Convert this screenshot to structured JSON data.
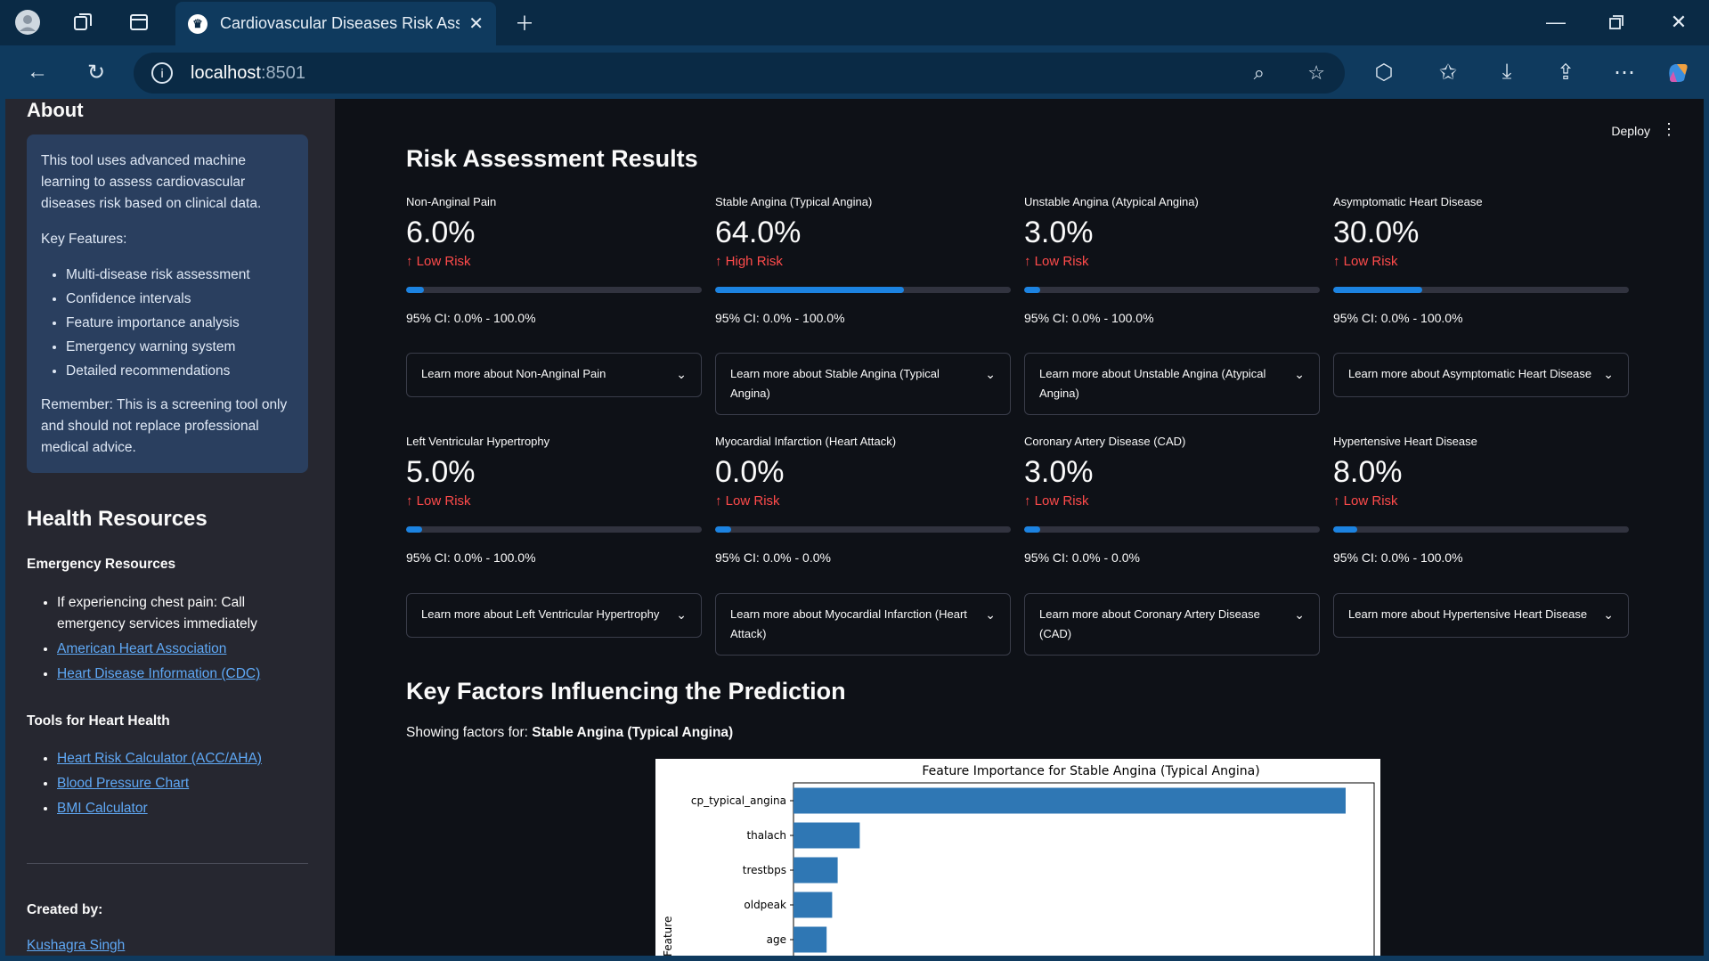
{
  "browser": {
    "tab_title": "Cardiovascular Diseases Risk Asse",
    "url_host": "localhost",
    "url_port": ":8501"
  },
  "sidebar": {
    "about_title": "About",
    "about_intro": "This tool uses advanced machine learning to assess cardiovascular diseases risk based on clinical data.",
    "key_features_label": "Key Features:",
    "features": [
      "Multi-disease risk assessment",
      "Confidence intervals",
      "Feature importance analysis",
      "Emergency warning system",
      "Detailed recommendations"
    ],
    "remember": "Remember: This is a screening tool only and should not replace professional medical advice.",
    "health_resources_title": "Health Resources",
    "emergency_title": "Emergency Resources",
    "emergency_items": [
      "If experiencing chest pain: Call emergency services immediately"
    ],
    "emergency_links": [
      "American Heart Association",
      "Heart Disease Information (CDC)"
    ],
    "tools_title": "Tools for Heart Health",
    "tools_links": [
      "Heart Risk Calculator (ACC/AHA)",
      "Blood Pressure Chart",
      "BMI Calculator"
    ],
    "created_by_label": "Created by:",
    "author": "Kushagra Singh"
  },
  "header": {
    "deploy_label": "Deploy",
    "menu_icon": "kebab-icon"
  },
  "results": {
    "title": "Risk Assessment Results",
    "metrics": [
      {
        "label": "Non-Anginal Pain",
        "value": "6.0%",
        "delta": "Low Risk",
        "progress": 0.06,
        "ci": "95% CI: 0.0% - 100.0%",
        "expander": "Learn more about Non-Anginal Pain"
      },
      {
        "label": "Stable Angina (Typical Angina)",
        "value": "64.0%",
        "delta": "High Risk",
        "progress": 0.64,
        "ci": "95% CI: 0.0% - 100.0%",
        "expander": "Learn more about Stable Angina (Typical Angina)"
      },
      {
        "label": "Unstable Angina (Atypical Angina)",
        "value": "3.0%",
        "delta": "Low Risk",
        "progress": 0.03,
        "ci": "95% CI: 0.0% - 100.0%",
        "expander": "Learn more about Unstable Angina (Atypical Angina)"
      },
      {
        "label": "Asymptomatic Heart Disease",
        "value": "30.0%",
        "delta": "Low Risk",
        "progress": 0.3,
        "ci": "95% CI: 0.0% - 100.0%",
        "expander": "Learn more about Asymptomatic Heart Disease"
      },
      {
        "label": "Left Ventricular Hypertrophy",
        "value": "5.0%",
        "delta": "Low Risk",
        "progress": 0.05,
        "ci": "95% CI: 0.0% - 100.0%",
        "expander": "Learn more about Left Ventricular Hypertrophy"
      },
      {
        "label": "Myocardial Infarction (Heart Attack)",
        "value": "0.0%",
        "delta": "Low Risk",
        "progress": 0.0,
        "ci": "95% CI: 0.0% - 0.0%",
        "expander": "Learn more about Myocardial Infarction (Heart Attack)"
      },
      {
        "label": "Coronary Artery Disease (CAD)",
        "value": "3.0%",
        "delta": "Low Risk",
        "progress": 0.03,
        "ci": "95% CI: 0.0% - 0.0%",
        "expander": "Learn more about Coronary Artery Disease (CAD)"
      },
      {
        "label": "Hypertensive Heart Disease",
        "value": "8.0%",
        "delta": "Low Risk",
        "progress": 0.08,
        "ci": "95% CI: 0.0% - 100.0%",
        "expander": "Learn more about Hypertensive Heart Disease"
      }
    ]
  },
  "factors": {
    "title": "Key Factors Influencing the Prediction",
    "showing_prefix": "Showing factors for: ",
    "showing_disease": "Stable Angina (Typical Angina)"
  },
  "chart_data": {
    "type": "bar",
    "orientation": "horizontal",
    "title": "Feature Importance for Stable Angina (Typical Angina)",
    "ylabel": "Feature",
    "xlabel": "",
    "categories": [
      "cp_typical_angina",
      "thalach",
      "trestbps",
      "oldpeak",
      "age"
    ],
    "values": [
      1.0,
      0.12,
      0.08,
      0.07,
      0.06
    ],
    "bar_color": "#2f77b4"
  },
  "colors": {
    "accent": "#1c83e1",
    "risk": "#ff4b4b",
    "link": "#5fa8f5"
  }
}
